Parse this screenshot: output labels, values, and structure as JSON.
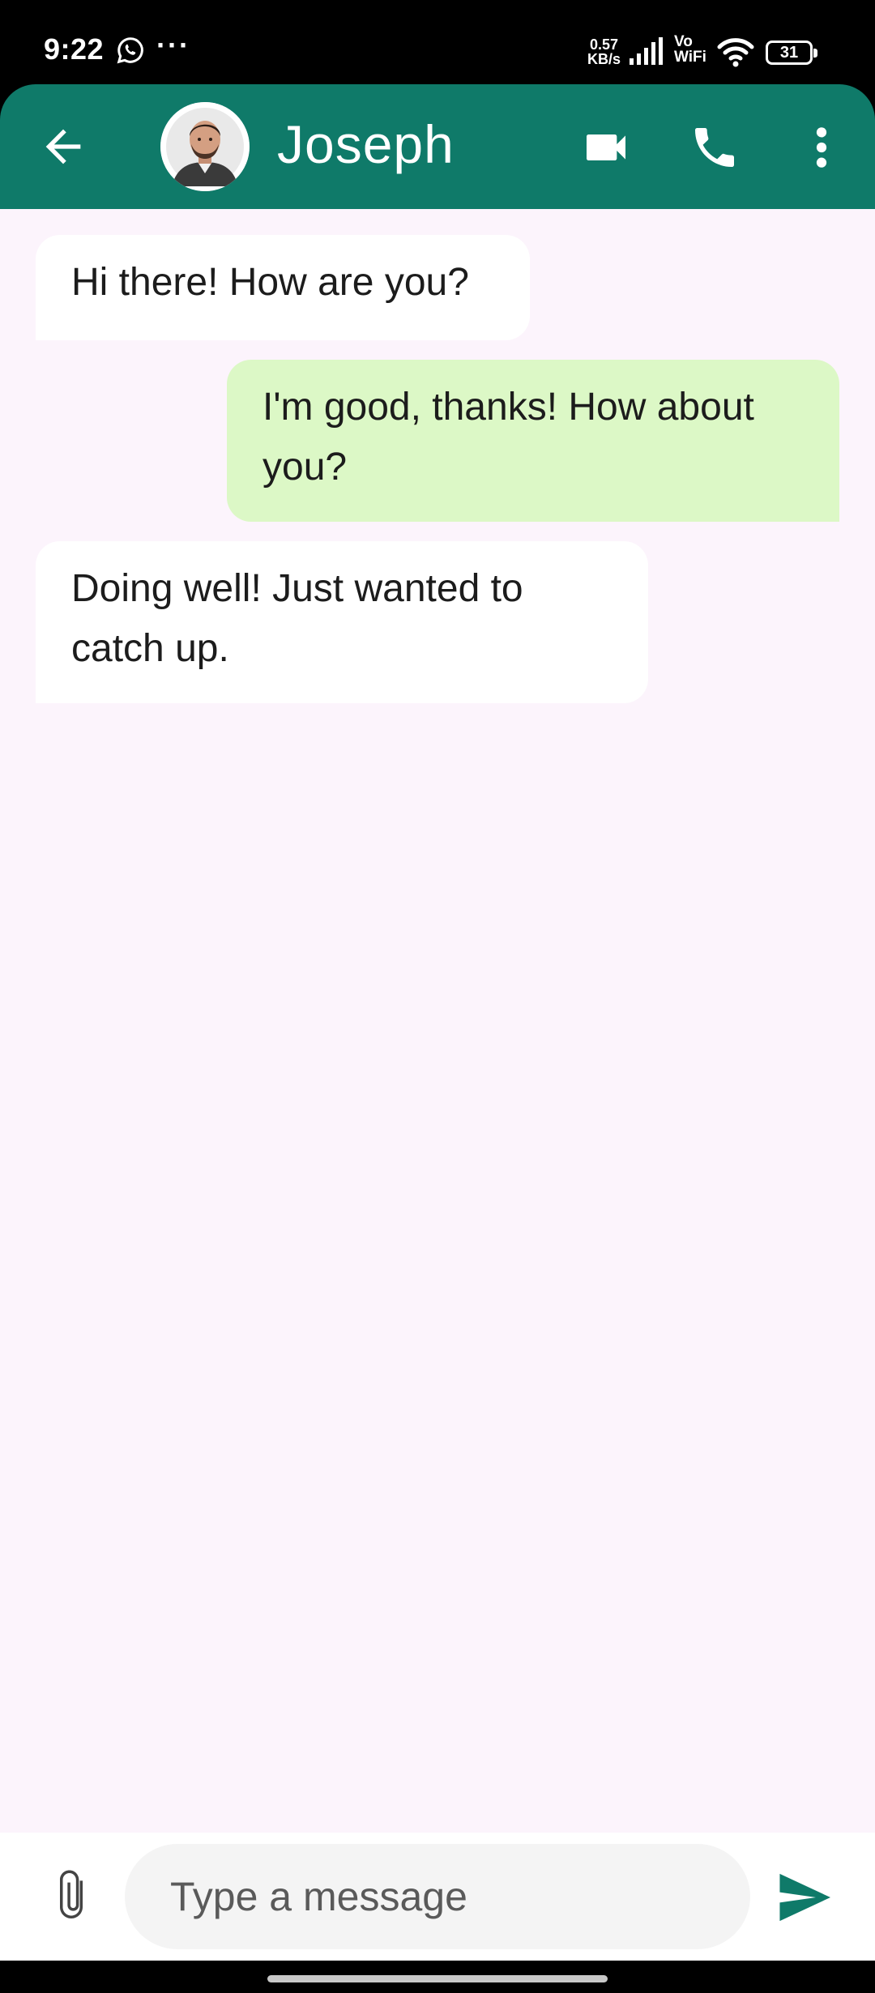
{
  "status_bar": {
    "time": "9:22",
    "more": "···",
    "speed_value": "0.57",
    "speed_unit": "KB/s",
    "vowifi_top": "Vo",
    "vowifi_bottom": "WiFi",
    "battery": "31"
  },
  "header": {
    "contact_name": "Joseph",
    "icons": [
      "back-arrow-icon",
      "video-camera-icon",
      "phone-icon",
      "more-vert-icon"
    ]
  },
  "messages": [
    {
      "direction": "incoming",
      "text": "Hi there! How are you?"
    },
    {
      "direction": "outgoing",
      "text": "I'm good, thanks! How about you?"
    },
    {
      "direction": "incoming",
      "text": "Doing well! Just wanted to catch up."
    }
  ],
  "composer": {
    "placeholder": "Type a message",
    "icons": [
      "paperclip-icon",
      "send-icon"
    ]
  },
  "colors": {
    "header": "#0f7a69",
    "chat_background": "#fcf4fc",
    "incoming_bubble": "#ffffff",
    "outgoing_bubble": "#dcf8c6",
    "send_icon": "#0f7a69"
  }
}
